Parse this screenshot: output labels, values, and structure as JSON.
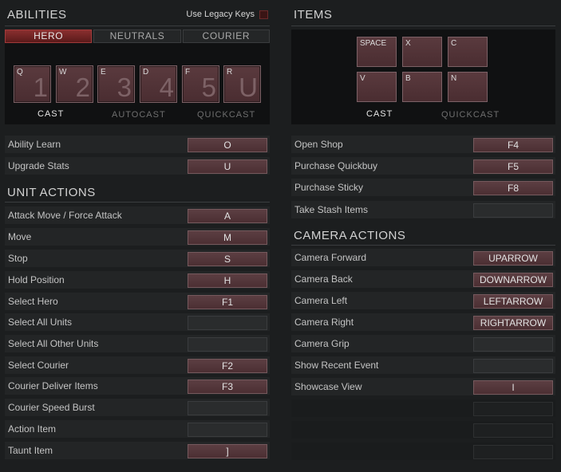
{
  "abilities": {
    "title": "ABILITIES",
    "legacy_label": "Use Legacy Keys",
    "tabs": [
      "HERO",
      "NEUTRALS",
      "COURIER"
    ],
    "keys": [
      {
        "hotkey": "Q",
        "number": "1"
      },
      {
        "hotkey": "W",
        "number": "2"
      },
      {
        "hotkey": "E",
        "number": "3"
      },
      {
        "hotkey": "D",
        "number": "4"
      },
      {
        "hotkey": "F",
        "number": "5"
      },
      {
        "hotkey": "R",
        "number": "U"
      }
    ],
    "modes": [
      "CAST",
      "AUTOCAST",
      "QUICKCAST"
    ],
    "rows": [
      {
        "label": "Ability Learn",
        "key": "O"
      },
      {
        "label": "Upgrade Stats",
        "key": "U"
      }
    ]
  },
  "unit_actions": {
    "title": "UNIT ACTIONS",
    "rows": [
      {
        "label": "Attack Move / Force Attack",
        "key": "A"
      },
      {
        "label": "Move",
        "key": "M"
      },
      {
        "label": "Stop",
        "key": "S"
      },
      {
        "label": "Hold Position",
        "key": "H"
      },
      {
        "label": "Select Hero",
        "key": "F1"
      },
      {
        "label": "Select All Units",
        "key": ""
      },
      {
        "label": "Select All Other Units",
        "key": ""
      },
      {
        "label": "Select Courier",
        "key": "F2"
      },
      {
        "label": "Courier Deliver Items",
        "key": "F3"
      },
      {
        "label": "Courier Speed Burst",
        "key": ""
      },
      {
        "label": "Action Item",
        "key": ""
      },
      {
        "label": "Taunt Item",
        "key": "]"
      }
    ]
  },
  "items": {
    "title": "ITEMS",
    "keys": [
      "SPACE",
      "X",
      "C",
      "V",
      "B",
      "N"
    ],
    "modes": [
      "CAST",
      "QUICKCAST"
    ],
    "rows": [
      {
        "label": "Open Shop",
        "key": "F4"
      },
      {
        "label": "Purchase Quickbuy",
        "key": "F5"
      },
      {
        "label": "Purchase Sticky",
        "key": "F8"
      },
      {
        "label": "Take Stash Items",
        "key": ""
      }
    ]
  },
  "camera_actions": {
    "title": "CAMERA ACTIONS",
    "rows": [
      {
        "label": "Camera Forward",
        "key": "UPARROW"
      },
      {
        "label": "Camera Back",
        "key": "DOWNARROW"
      },
      {
        "label": "Camera Left",
        "key": "LEFTARROW"
      },
      {
        "label": "Camera Right",
        "key": "RIGHTARROW"
      },
      {
        "label": "Camera Grip",
        "key": ""
      },
      {
        "label": "Show Recent Event",
        "key": ""
      },
      {
        "label": "Showcase View",
        "key": "I"
      },
      {
        "label": "",
        "key": ""
      },
      {
        "label": "",
        "key": ""
      },
      {
        "label": "",
        "key": ""
      }
    ]
  }
}
